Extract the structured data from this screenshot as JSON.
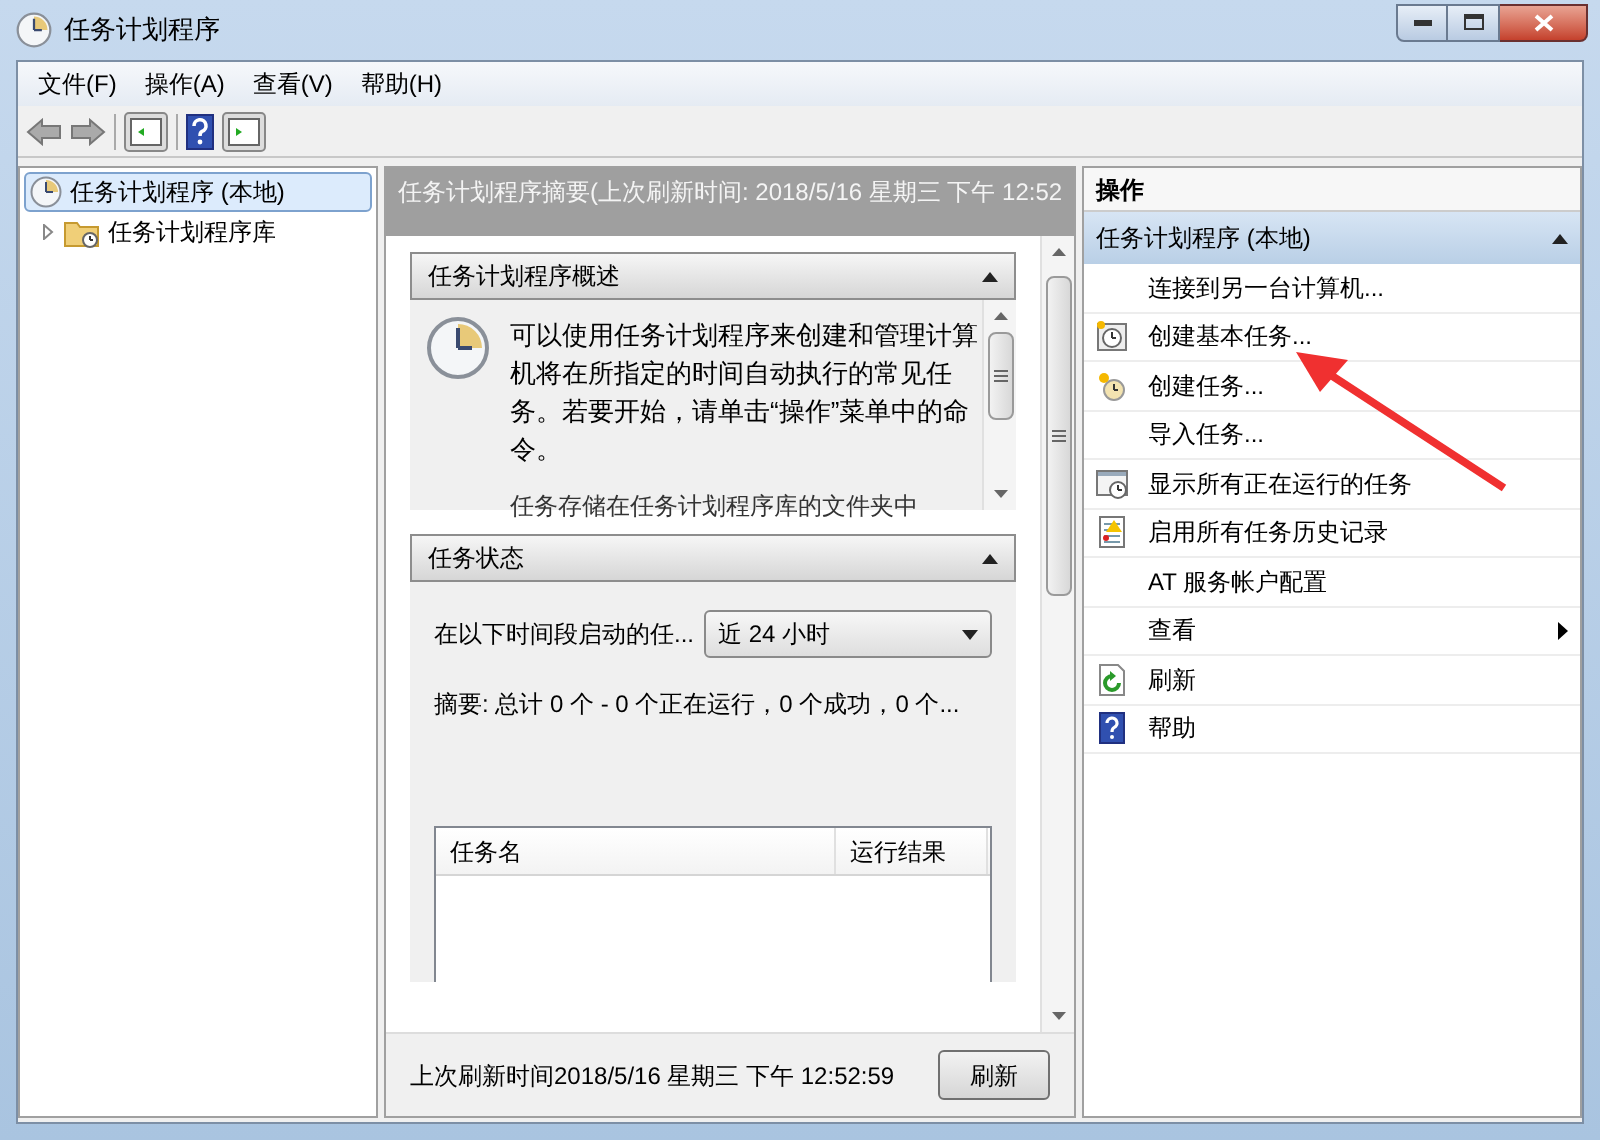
{
  "window": {
    "title": "任务计划程序"
  },
  "menu": [
    "文件(F)",
    "操作(A)",
    "查看(V)",
    "帮助(H)"
  ],
  "tree": [
    {
      "label": "任务计划程序 (本地)",
      "selected": true,
      "children": [
        {
          "label": "任务计划程序库",
          "selected": false,
          "expanded": false
        }
      ]
    }
  ],
  "summary": {
    "header": "任务计划程序摘要(上次刷新时间: 2018/5/16 星期三 下午 12:52",
    "sections": [
      {
        "kind": "overview",
        "title": "任务计划程序概述",
        "expanded": true,
        "text": "可以使用任务计划程序来创建和管理计算机将在所指定的时间自动执行的常见任务。若要开始，请单击“操作”菜单中的命令。",
        "text_2": "任务存储在任务计划程序库的文件夹中"
      },
      {
        "kind": "status",
        "title": "任务状态",
        "expanded": true,
        "period_label": "在以下时间段启动的任...",
        "period_value": "近 24 小时",
        "summary": "摘要: 总计 0 个 - 0 个正在运行，0 个成功，0 个...",
        "columns": [
          "任务名",
          "运行结果"
        ]
      }
    ],
    "footer": {
      "text": "上次刷新时间2018/5/16 星期三 下午 12:52:59",
      "button": "刷新"
    }
  },
  "actions": {
    "title": "操作",
    "group": {
      "title": "任务计划程序 (本地)",
      "expanded": true
    },
    "items": [
      {
        "kind": "action",
        "label": "连接到另一台计算机..."
      },
      {
        "kind": "action",
        "label": "创建基本任务..."
      },
      {
        "kind": "action",
        "label": "创建任务..."
      },
      {
        "kind": "action",
        "label": "导入任务..."
      },
      {
        "kind": "action",
        "label": "显示所有正在运行的任务"
      },
      {
        "kind": "action",
        "label": "启用所有任务历史记录"
      },
      {
        "kind": "action",
        "label": "AT 服务帐户配置"
      },
      {
        "kind": "submenu",
        "label": "查看"
      },
      {
        "kind": "action",
        "label": "刷新"
      },
      {
        "kind": "action",
        "label": "帮助"
      }
    ]
  }
}
